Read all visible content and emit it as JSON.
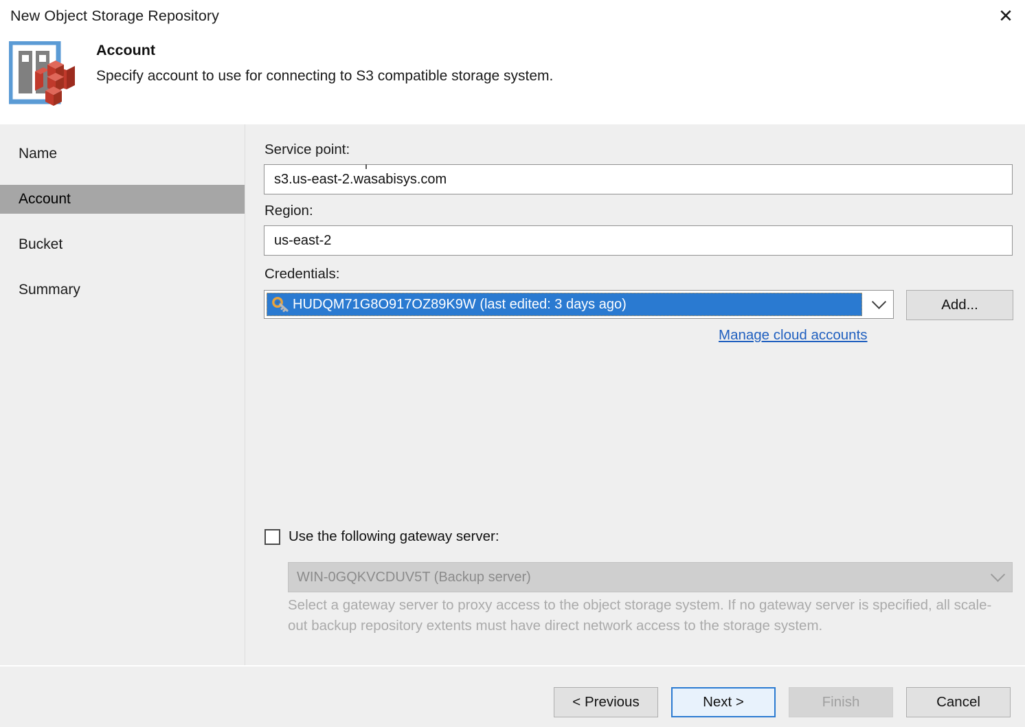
{
  "window": {
    "title": "New Object Storage Repository",
    "close_label": "✕"
  },
  "header": {
    "step_title": "Account",
    "step_description": "Specify account to use for connecting to S3 compatible storage system.",
    "icon": "object-storage-s3-icon"
  },
  "sidebar": {
    "items": [
      {
        "label": "Name",
        "selected": false
      },
      {
        "label": "Account",
        "selected": true
      },
      {
        "label": "Bucket",
        "selected": false
      },
      {
        "label": "Summary",
        "selected": false
      }
    ]
  },
  "form": {
    "service_point": {
      "label": "Service point:",
      "value": "s3.us-east-2.wasabisys.com"
    },
    "region": {
      "label": "Region:",
      "value": "us-east-2"
    },
    "credentials": {
      "label": "Credentials:",
      "selected_value": "HUDQM71G8O917OZ89K9W (last edited: 3 days ago)",
      "icon": "key-icon",
      "add_button": "Add...",
      "manage_link": "Manage cloud accounts",
      "dropdown_icon": "chevron-down-icon"
    },
    "gateway": {
      "checkbox_label": "Use the following gateway server:",
      "checked": false,
      "server_value": "WIN-0GQKVCDUV5T (Backup server)",
      "dropdown_icon": "chevron-down-icon",
      "helper_text": "Select a gateway server to proxy access to the object storage system. If no gateway server is specified, all scale-out backup repository extents must have direct network access to the storage system."
    }
  },
  "footer": {
    "previous": "< Previous",
    "next": "Next >",
    "finish": "Finish",
    "cancel": "Cancel"
  },
  "colors": {
    "accent": "#2a7ad1",
    "link": "#1f5fbf",
    "selection": "#2a7ad1",
    "sidebar_selected": "#a6a6a6",
    "body_bg": "#efefef"
  }
}
